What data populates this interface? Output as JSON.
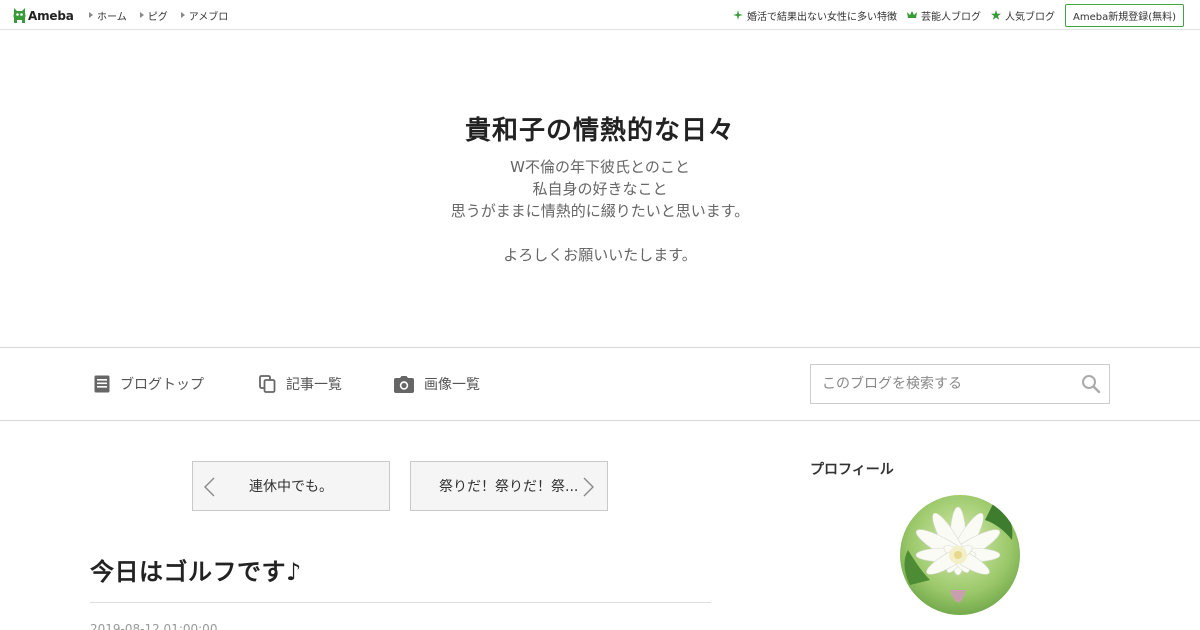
{
  "topbar": {
    "logo_text": "Ameba",
    "left_links": [
      "ホーム",
      "ピグ",
      "アメブロ"
    ],
    "right_links": [
      {
        "label": "婚活で結果出ない女性に多い特徴",
        "icon": "sparkle-icon"
      },
      {
        "label": "芸能人ブログ",
        "icon": "crown-icon"
      },
      {
        "label": "人気ブログ",
        "icon": "star-icon"
      }
    ],
    "register_label": "Ameba新規登録(無料)"
  },
  "header": {
    "title": "貴和子の情熱的な日々",
    "description": [
      "W不倫の年下彼氏とのこと",
      "私自身の好きなこと",
      "思うがままに情熱的に綴りたいと思います。",
      "",
      "よろしくお願いいたします。"
    ]
  },
  "global_nav": {
    "items": [
      {
        "label": "ブログトップ",
        "icon": "document-icon"
      },
      {
        "label": "記事一覧",
        "icon": "copy-icon"
      },
      {
        "label": "画像一覧",
        "icon": "camera-icon"
      }
    ],
    "search_placeholder": "このブログを検索する"
  },
  "pager": {
    "prev_label": "連休中でも。",
    "next_label": "祭りだ！祭りだ！祭..."
  },
  "entry": {
    "title": "今日はゴルフです♪",
    "date": "2019-08-12 01:00:00"
  },
  "sidebar": {
    "profile_heading": "プロフィール"
  },
  "colors": {
    "ameba_green": "#2d8a2d",
    "border": "#d8d8d8"
  }
}
